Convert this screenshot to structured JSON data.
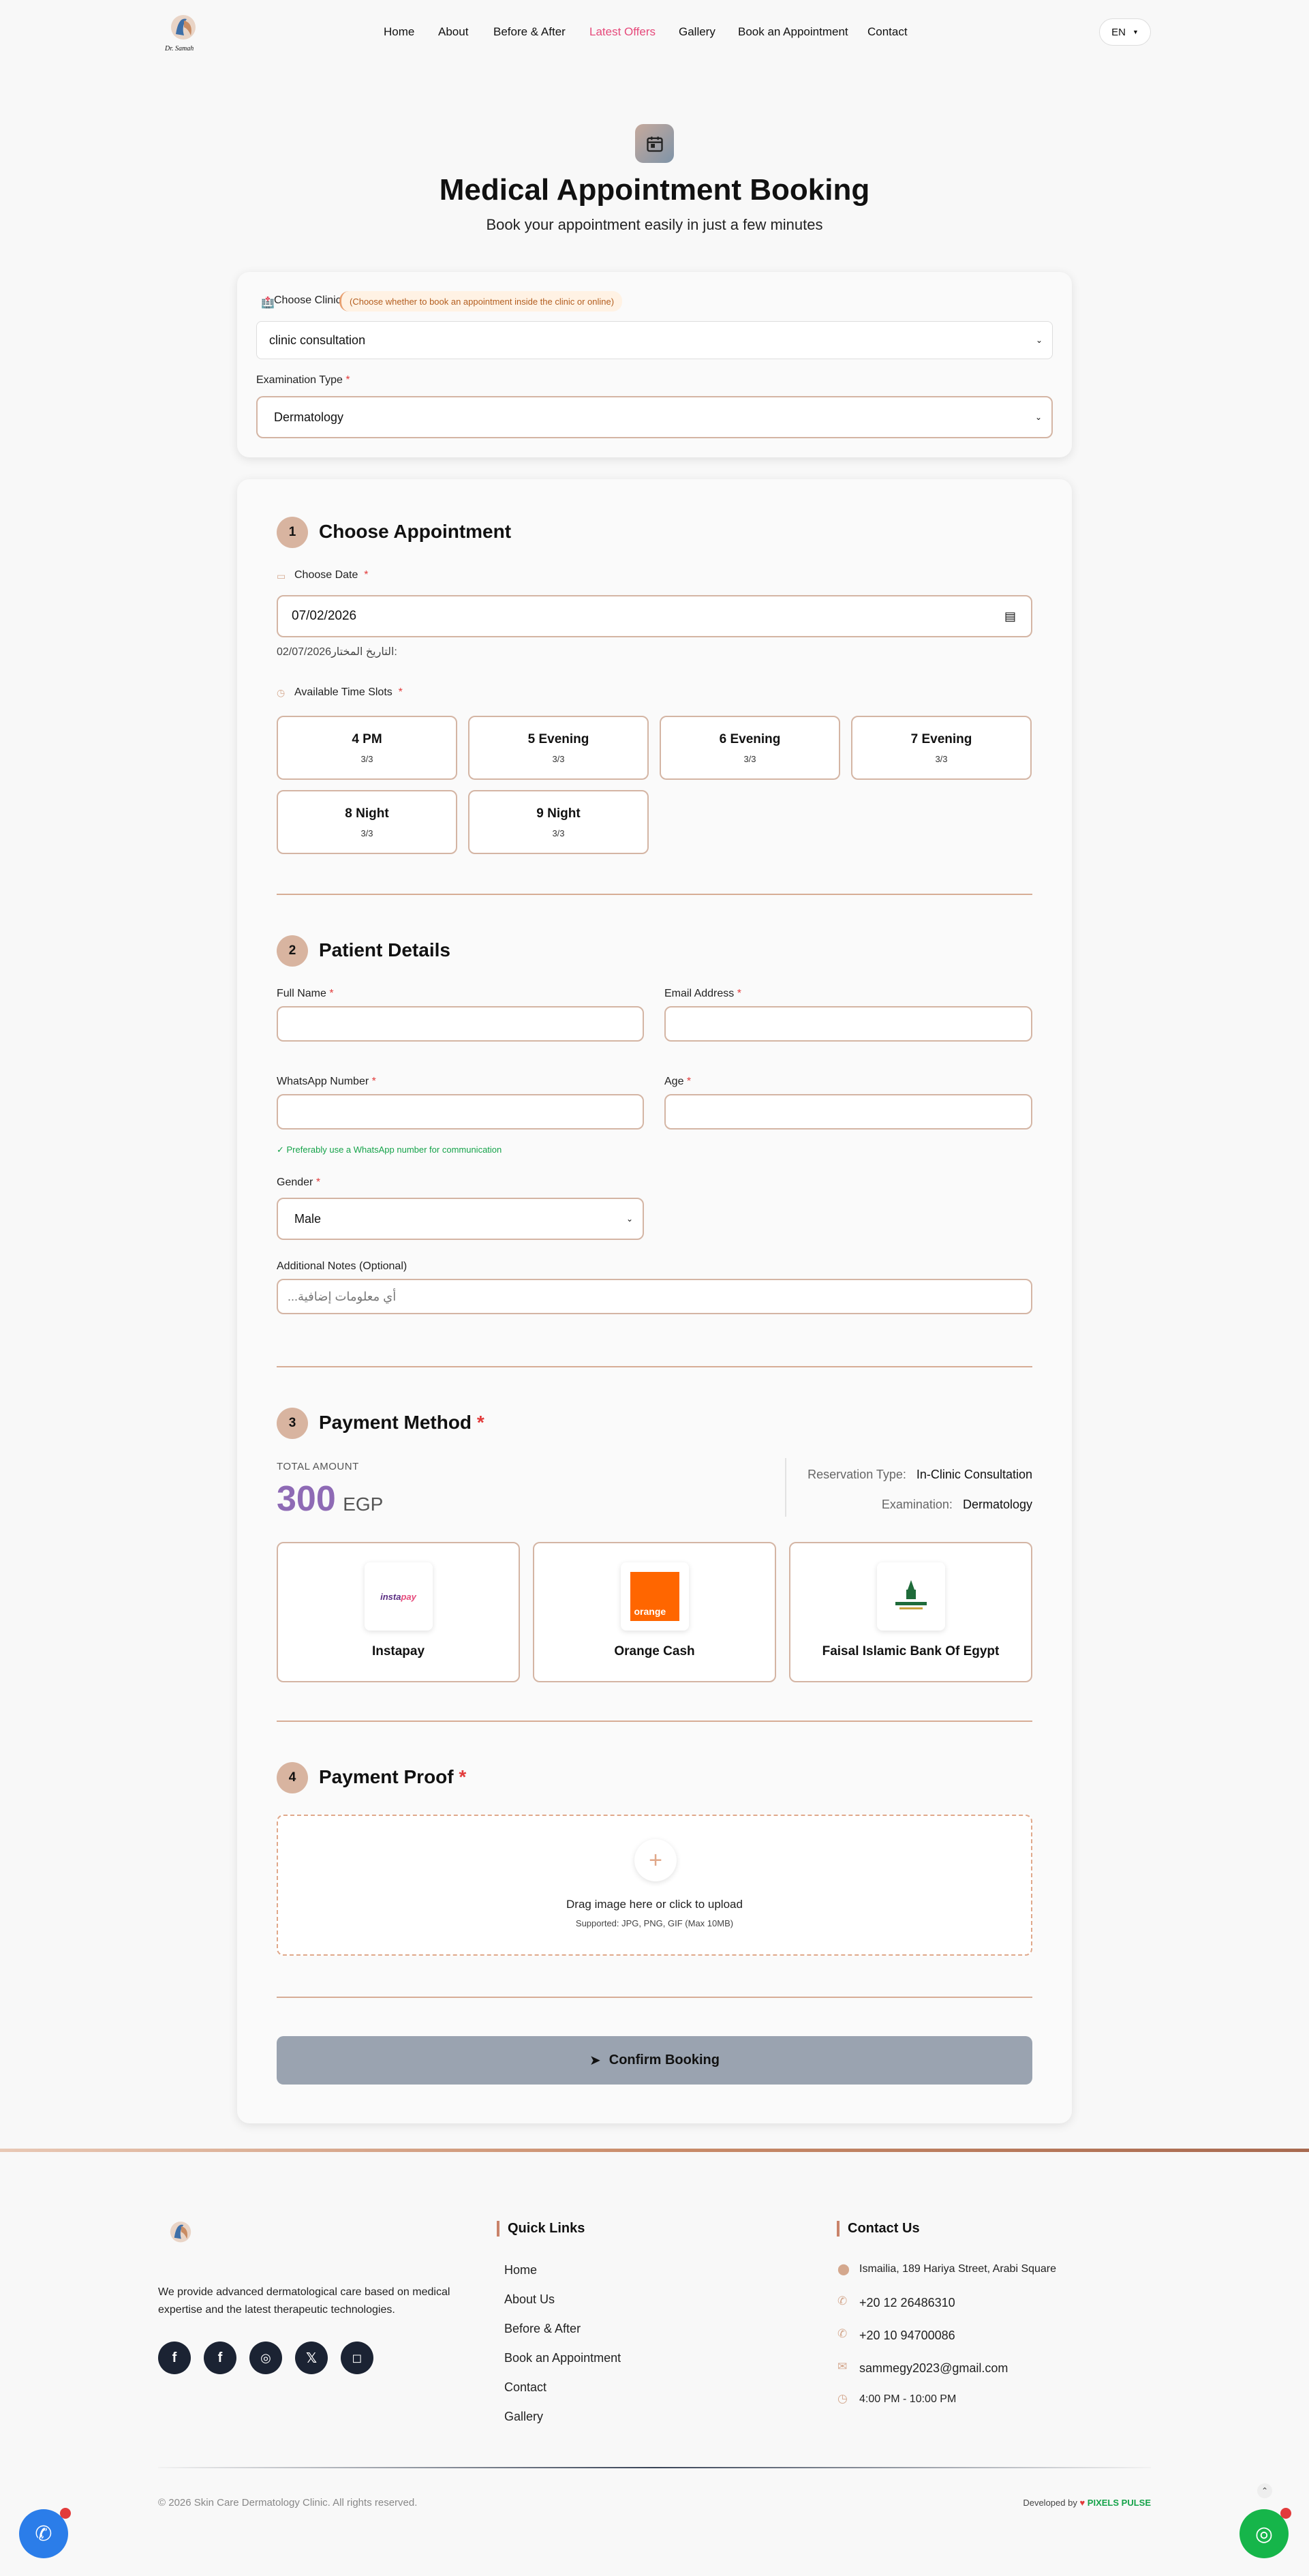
{
  "nav": {
    "logo_text": "Dr. Samah",
    "links": [
      "Home",
      "About",
      "Before & After",
      "Latest Offers",
      "Gallery",
      "Book an Appointment",
      "Contact"
    ],
    "active_link": "Latest Offers",
    "active_color": "#e64a7b",
    "lang": "EN"
  },
  "hero": {
    "icon": "calendar-icon",
    "title": "Medical Appointment Booking",
    "subtitle": "Book your appointment easily in just a few minutes"
  },
  "clinic": {
    "label": "Choose Clinic",
    "hint": "(Choose whether to book an appointment inside the clinic or online)",
    "selected": "clinic consultation",
    "exam_label": "Examination Type",
    "exam_selected": "Dermatology"
  },
  "step1": {
    "num": "1",
    "title": "Choose Appointment",
    "date_label": "Choose Date",
    "date_value": "07/02/2026",
    "date_note": "02/07/2026التاريخ المختار:",
    "slots_label": "Available Time Slots",
    "slots": [
      {
        "time": "4 PM",
        "count": "3/3"
      },
      {
        "time": "5 Evening",
        "count": "3/3"
      },
      {
        "time": "6 Evening",
        "count": "3/3"
      },
      {
        "time": "7 Evening",
        "count": "3/3"
      },
      {
        "time": "8 Night",
        "count": "3/3"
      },
      {
        "time": "9 Night",
        "count": "3/3"
      }
    ]
  },
  "step2": {
    "num": "2",
    "title": "Patient Details",
    "full_name": "Full Name",
    "email": "Email Address",
    "whatsapp": "WhatsApp Number",
    "age": "Age",
    "whatsapp_hint": "✓ Preferably use a WhatsApp number for communication",
    "gender": "Gender",
    "gender_value": "Male",
    "notes_label": "Additional Notes (Optional)",
    "notes_placeholder": "أي معلومات إضافية..."
  },
  "step3": {
    "num": "3",
    "title": "Payment Method",
    "total_label": "TOTAL AMOUNT",
    "amount": "300",
    "currency": "EGP",
    "res_type_label": "Reservation Type:",
    "res_type_value": "In-Clinic Consultation",
    "exam_label": "Examination:",
    "exam_value": "Dermatology",
    "methods": [
      {
        "name": "Instapay",
        "logo": "instapay"
      },
      {
        "name": "Orange Cash",
        "logo": "orange"
      },
      {
        "name": "Faisal Islamic Bank Of Egypt",
        "logo": "faisal"
      }
    ]
  },
  "step4": {
    "num": "4",
    "title": "Payment Proof",
    "upload_title": "Drag image here or click to upload",
    "upload_sub": "Supported: JPG, PNG, GIF (Max 10MB)"
  },
  "confirm": "Confirm Booking",
  "footer": {
    "about": "We provide advanced dermatological care based on medical expertise and the latest therapeutic technologies.",
    "quick_title": "Quick Links",
    "quick_links": [
      "Home",
      "About Us",
      "Before & After",
      "Book an Appointment",
      "Contact",
      "Gallery"
    ],
    "contact_title": "Contact Us",
    "address": "Ismailia, 189 Hariya Street, Arabi Square",
    "phone1": "+20 12 26486310",
    "phone2": "+20 10 94700086",
    "email": "sammegy2023@gmail.com",
    "hours": "4:00 PM - 10:00 PM",
    "copyright": "2026 Skin Care Dermatology Clinic. All rights reserved.",
    "developed_by": "Developed by",
    "dev_name": "PIXELS PULSE"
  },
  "colors": {
    "accent": "#d8b4a0",
    "border": "#d4b5a4",
    "whatsapp": "#16b54a",
    "phone": "#2b7de9"
  }
}
